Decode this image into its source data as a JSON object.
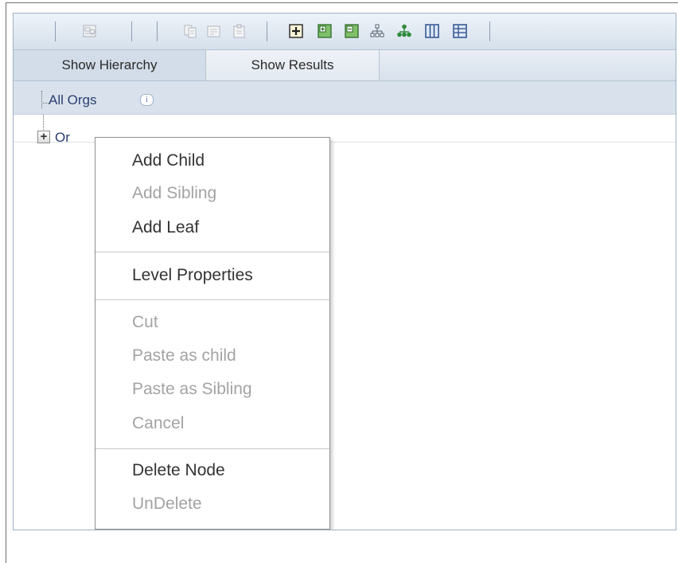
{
  "toolbar": {
    "buttons": [
      {
        "icon": "view-details-icon",
        "enabled": false
      },
      {
        "icon": "copy-icon",
        "enabled": false
      },
      {
        "icon": "cut-icon",
        "enabled": false
      },
      {
        "icon": "paste-icon",
        "enabled": false
      },
      {
        "icon": "add-child-icon",
        "enabled": true
      },
      {
        "icon": "expand-icon",
        "enabled": true
      },
      {
        "icon": "collapse-icon",
        "enabled": true
      },
      {
        "icon": "hierarchy-icon",
        "enabled": true
      },
      {
        "icon": "org-tree-icon",
        "enabled": true
      },
      {
        "icon": "columns-icon",
        "enabled": true
      },
      {
        "icon": "grid-icon",
        "enabled": true
      }
    ]
  },
  "tabs": {
    "hierarchy": "Show Hierarchy",
    "results": "Show Results"
  },
  "breadcrumb": {
    "label": "All Orgs",
    "info_glyph": "i"
  },
  "tree": {
    "node_label": "Or",
    "expander_glyph": "+"
  },
  "context_menu": {
    "add_child": "Add Child",
    "add_sibling": "Add Sibling",
    "add_leaf": "Add Leaf",
    "level_properties": "Level Properties",
    "cut": "Cut",
    "paste_as_child": "Paste as child",
    "paste_as_sibling": "Paste as Sibling",
    "cancel": "Cancel",
    "delete_node": "Delete Node",
    "undelete": "UnDelete"
  },
  "colors": {
    "toolbar_bg": "#dbe4ef",
    "active_tab": "#d3dde9",
    "link_text": "#2a3f70",
    "menu_enabled": "#333333",
    "menu_disabled": "#a3a3a3",
    "icon_green": "#2f8a3a",
    "icon_blue": "#2b4e8f"
  }
}
